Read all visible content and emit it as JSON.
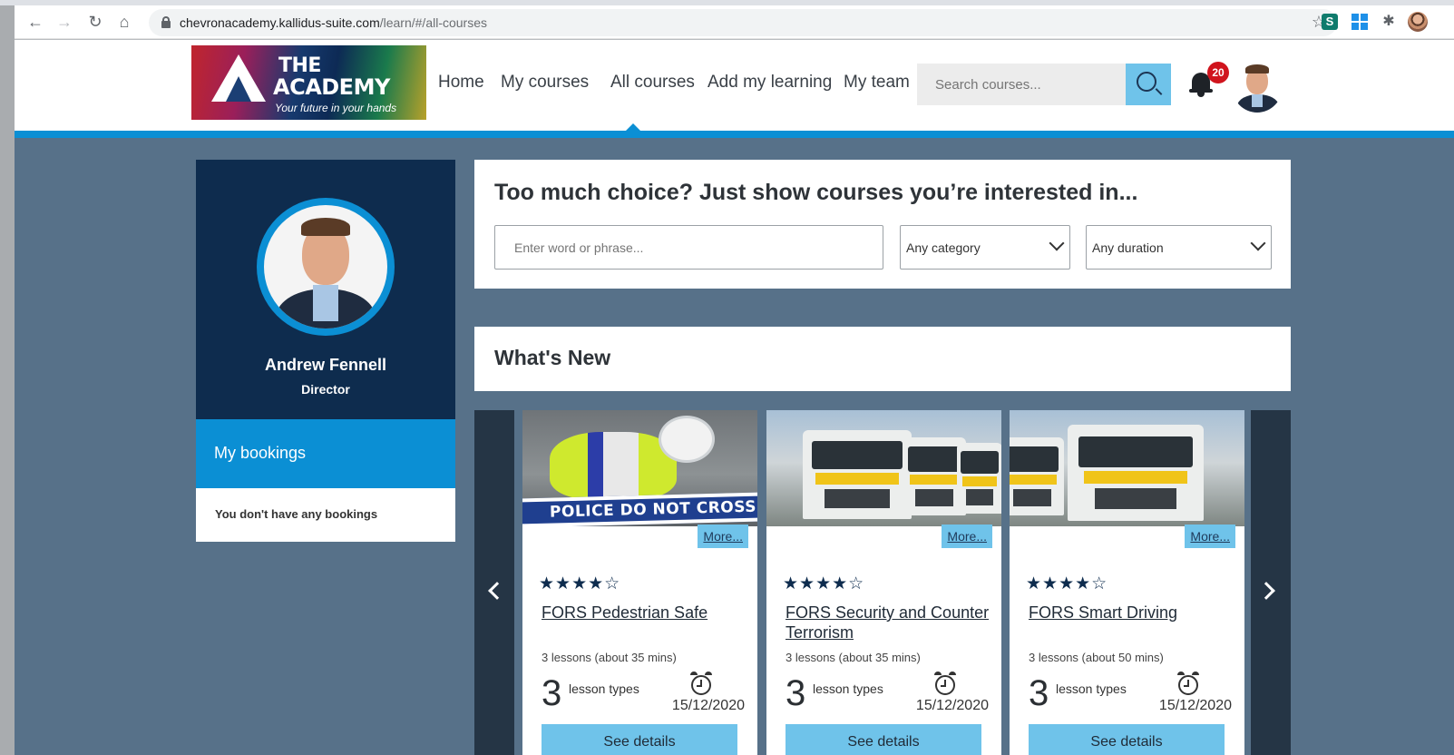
{
  "browser": {
    "url_host": "chevronacademy.kallidus-suite.com",
    "url_path": "/learn/#/all-courses"
  },
  "logo": {
    "line1": "THE",
    "line2": "ACADEMY",
    "tagline": "Your future in your hands"
  },
  "nav": {
    "items": [
      {
        "label": "Home"
      },
      {
        "label": "My courses"
      },
      {
        "label": "All courses"
      },
      {
        "label": "Add my learning"
      },
      {
        "label": "My team"
      }
    ],
    "active": "All courses",
    "search_placeholder": "Search courses...",
    "notification_count": "20"
  },
  "profile": {
    "name": "Andrew Fennell",
    "role": "Director"
  },
  "bookings": {
    "title": "My bookings",
    "empty_text": "You don't have any bookings"
  },
  "filters": {
    "title": "Too much choice? Just show courses you’re interested in...",
    "keyword_placeholder": "Enter word or phrase...",
    "category": "Any category",
    "duration": "Any duration"
  },
  "whats_new": {
    "title": "What's New"
  },
  "courses": [
    {
      "image_text": "POLICE DO NOT CROSS",
      "more": "More...",
      "rating": 4,
      "stars": "★★★★☆",
      "title": "FORS Pedestrian Safe",
      "lessons": "3 lessons (about 35 mins)",
      "lesson_type_count": "3",
      "lesson_type_label": "lesson types",
      "date": "15/12/2020",
      "button": "See details"
    },
    {
      "more": "More...",
      "rating": 4,
      "stars": "★★★★☆",
      "title": "FORS Security and Counter Terrorism",
      "lessons": "3 lessons (about 35 mins)",
      "lesson_type_count": "3",
      "lesson_type_label": "lesson types",
      "date": "15/12/2020",
      "button": "See details"
    },
    {
      "more": "More...",
      "rating": 4,
      "stars": "★★★★☆",
      "title": "FORS Smart Driving",
      "lessons": "3 lessons (about 50 mins)",
      "lesson_type_count": "3",
      "lesson_type_label": "lesson types",
      "date": "15/12/2020",
      "button": "See details"
    }
  ],
  "colors": {
    "brand_blue": "#0b8fd4",
    "navy": "#0e2c4e",
    "light_blue": "#6fc3ea",
    "page_bg": "#577189",
    "badge_red": "#d0141d"
  },
  "icons": [
    "back-icon",
    "forward-icon",
    "reload-icon",
    "home-icon",
    "lock-icon",
    "bookmark-star-icon",
    "extension-icon",
    "search-icon",
    "bell-icon",
    "chevron-down-icon",
    "chevron-left-icon",
    "chevron-right-icon",
    "alarm-clock-icon",
    "star-icon"
  ]
}
